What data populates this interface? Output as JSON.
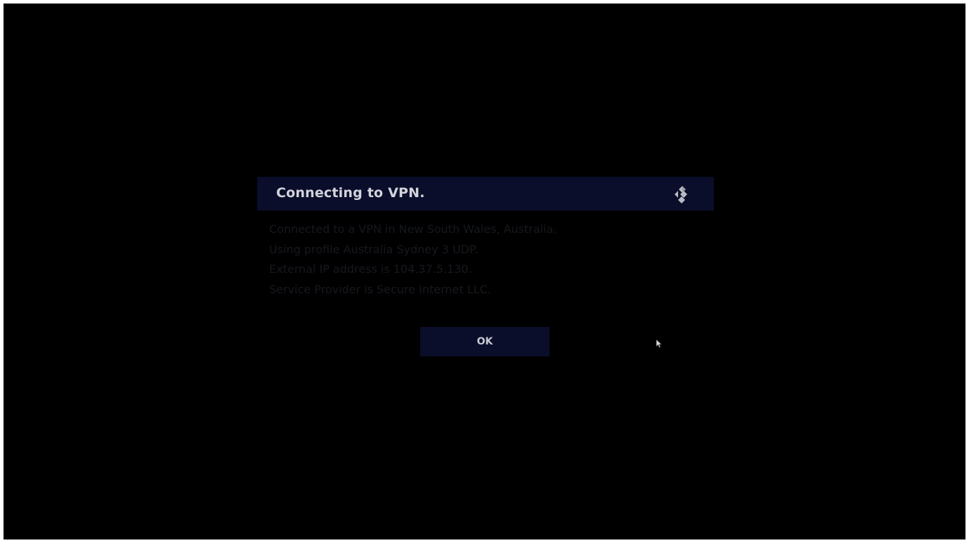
{
  "dialog": {
    "title": "Connecting to VPN.",
    "logo_icon": "kodi-logo-icon",
    "lines": [
      "Connected to a VPN in New South Wales, Australia.",
      "Using profile Australia Sydney 3 UDP.",
      "External IP address is 104.37.5.130.",
      "Service Provider is Secure Internet LLC."
    ],
    "ok_label": "OK"
  },
  "colors": {
    "background": "#000000",
    "dialog_panel": "#0a0e2a",
    "title_text": "#d3d4dc",
    "body_text": "#16181e"
  },
  "cursor_icon": "mouse-pointer-icon"
}
